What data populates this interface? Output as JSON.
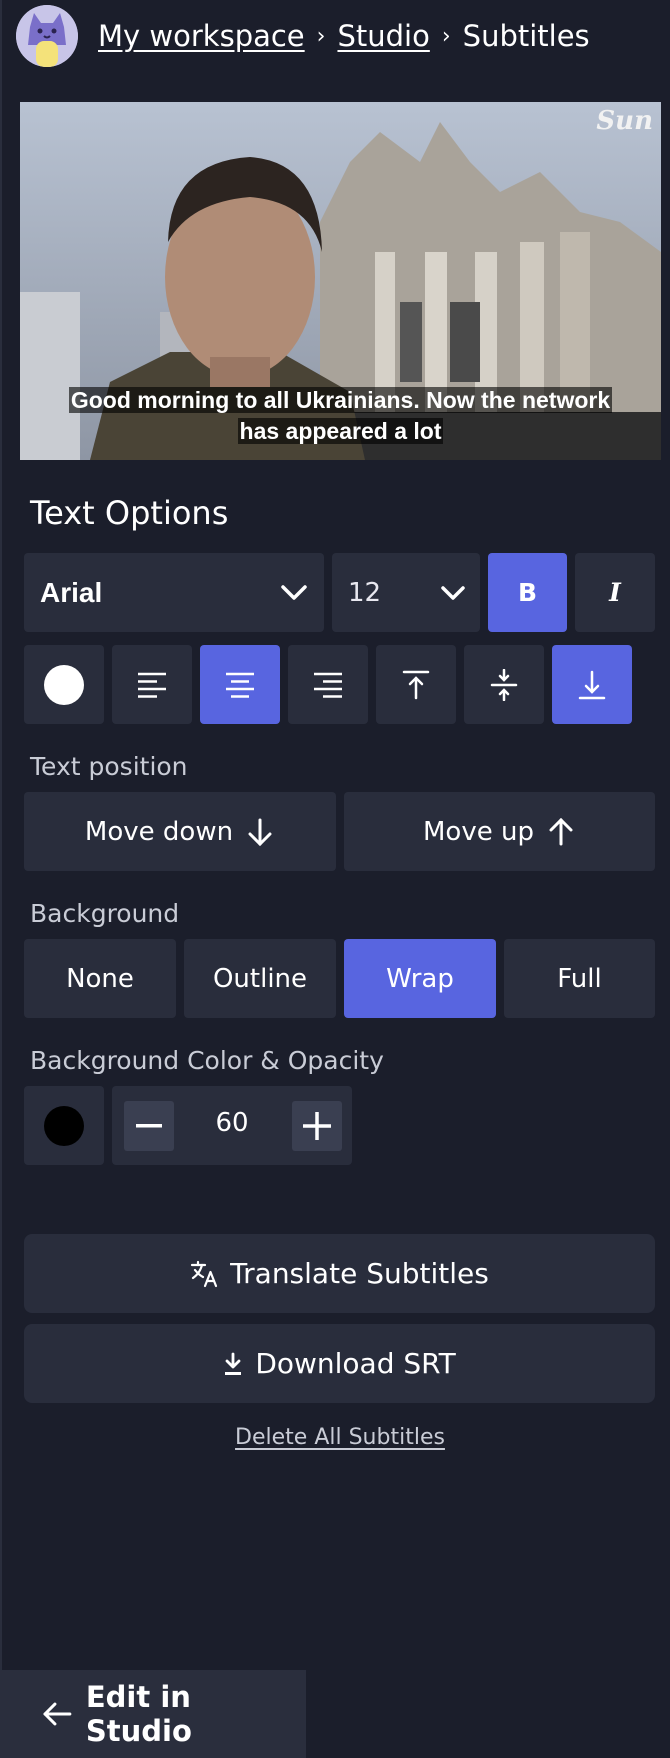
{
  "breadcrumb": {
    "items": [
      "My workspace",
      "Studio"
    ],
    "current": "Subtitles"
  },
  "video": {
    "subtitle": "Good morning to all Ukrainians. Now the network has appeared a lot",
    "watermark": "Sun"
  },
  "text_options": {
    "title": "Text Options",
    "font": "Arial",
    "size": "12",
    "bold_label": "B",
    "italic_label": "I",
    "text_color": "#ffffff",
    "align_selected": "center",
    "vertical_selected": "bottom"
  },
  "text_position": {
    "label": "Text position",
    "move_down": "Move down",
    "move_up": "Move up"
  },
  "background": {
    "label": "Background",
    "options": [
      "None",
      "Outline",
      "Wrap",
      "Full"
    ],
    "selected": "Wrap"
  },
  "bg_color": {
    "label": "Background Color & Opacity",
    "color": "#000000",
    "opacity": "60"
  },
  "actions": {
    "translate": "Translate Subtitles",
    "download": "Download SRT",
    "delete": "Delete All Subtitles"
  },
  "footer": {
    "edit_in_studio": "Edit in Studio"
  },
  "colors": {
    "accent": "#5865e0",
    "panel": "#292d3c",
    "background": "#1b1e2b"
  }
}
